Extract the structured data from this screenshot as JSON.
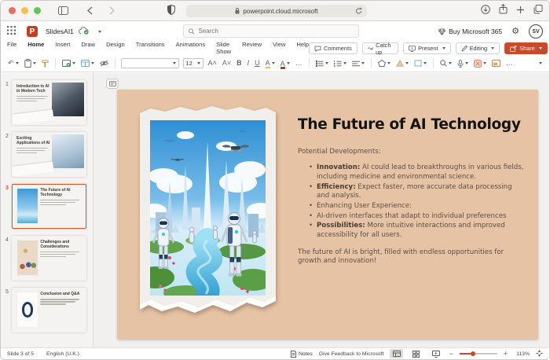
{
  "browser": {
    "url": "powerpoint.cloud.microsoft"
  },
  "titlebar": {
    "doc_name": "SlidesAI1",
    "search_placeholder": "Search",
    "buy_label": "Buy Microsoft 365",
    "avatar": "SV"
  },
  "menubar": {
    "items": [
      "File",
      "Home",
      "Insert",
      "Draw",
      "Design",
      "Transitions",
      "Animations",
      "Slide Show",
      "Review",
      "View",
      "Help"
    ],
    "active": "Home",
    "comments": "Comments",
    "catch_up": "Catch up",
    "present": "Present",
    "editing": "Editing",
    "share": "Share"
  },
  "ribbon": {
    "font_size": "12",
    "glyphs": {
      "undo": "↶",
      "bold": "B",
      "italic": "I",
      "underline": "U",
      "font_color": "A",
      "highlight": "A",
      "more": "…"
    }
  },
  "panel": {
    "thumbnails": [
      {
        "number": "1",
        "title": "Introduction to AI in Modern Tech",
        "theme": "olive",
        "image": "right",
        "variant": "robot",
        "selected": false
      },
      {
        "number": "2",
        "title": "Exciting Applications of AI",
        "theme": "olive",
        "image": "right",
        "variant": "device",
        "selected": false
      },
      {
        "number": "3",
        "title": "The Future of AI Technology",
        "theme": "peach",
        "image": "left",
        "variant": "city",
        "selected": true
      },
      {
        "number": "4",
        "title": "Challenges and Considerations",
        "theme": "peach",
        "image": "left",
        "variant": "people",
        "selected": false
      },
      {
        "number": "5",
        "title": "Conclusion and Q&A",
        "theme": "peach",
        "image": "left",
        "variant": "diagram",
        "selected": false
      }
    ]
  },
  "slide": {
    "title": "The Future of AI Technology",
    "intro": "Potential Developments:",
    "bullets": [
      {
        "lead": "Innovation:",
        "text": "AI could lead to breakthroughs in various fields, including medicine and environmental science."
      },
      {
        "lead": "Efficiency:",
        "text": "Expect faster, more accurate data processing and analysis."
      },
      {
        "lead": "",
        "text": "Enhancing User Experience:"
      },
      {
        "lead": "",
        "text": "AI-driven interfaces that adapt to individual preferences"
      },
      {
        "lead": "Possibilities:",
        "text": "More intuitive interactions and improved accessibility for all users."
      }
    ],
    "closing": "The future of AI is bright, filled with endless opportunities for growth and innovation!"
  },
  "statusbar": {
    "slide_position": "Slide 3 of 5",
    "language": "English (U.K.)",
    "notes": "Notes",
    "feedback": "Give Feedback to Microsoft",
    "zoom_level": "113%",
    "zoom_minus": "−",
    "zoom_plus": "+"
  },
  "colors": {
    "share_button": "#C64A2C",
    "accent_underline": "#B7472A",
    "slide_background": "#E7C3A5",
    "olive_thumb": "#DFE0C3",
    "selection_border": "#D05A2B"
  }
}
